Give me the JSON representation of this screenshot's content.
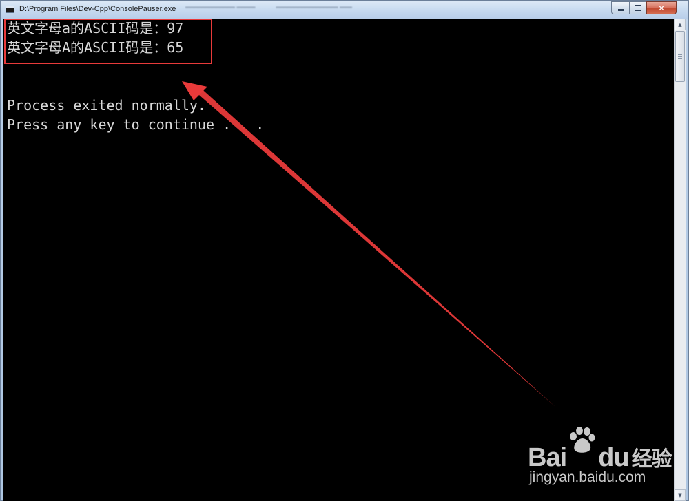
{
  "window": {
    "title": "D:\\Program Files\\Dev-Cpp\\ConsolePauser.exe",
    "icon": "console-app-icon",
    "controls": {
      "minimize_icon": "minimize-icon",
      "maximize_icon": "maximize-icon",
      "close_label": "✕"
    }
  },
  "console": {
    "lines": [
      "英文字母a的ASCII码是：97",
      "英文字母A的ASCII码是：65",
      "Process exited normally.",
      "Press any key to continue . . ."
    ],
    "background": "#000000",
    "text_color": "#d8d8d8"
  },
  "annotation": {
    "highlight_color": "#e83a3a",
    "arrow_color": "#e83a3a"
  },
  "watermark": {
    "brand": "Bai",
    "brand_suffix": "du",
    "brand_cn": "经验",
    "url": "jingyan.baidu.com",
    "icon": "baidu-paw-icon"
  }
}
